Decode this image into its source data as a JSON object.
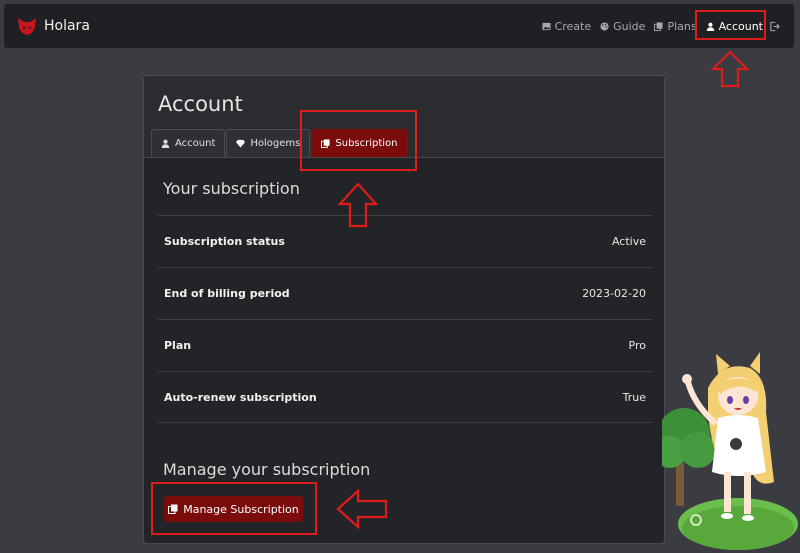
{
  "navbar": {
    "brand": "Holara",
    "links": [
      {
        "label": "Create",
        "icon": "image-icon"
      },
      {
        "label": "Guide",
        "icon": "palette-icon"
      },
      {
        "label": "Plans",
        "icon": "copy-icon"
      },
      {
        "label": "Account",
        "icon": "user-icon",
        "active": true
      }
    ],
    "logout_icon": "logout-icon"
  },
  "card": {
    "title": "Account",
    "tabs": [
      {
        "label": "Account",
        "icon": "user-icon"
      },
      {
        "label": "Hologems",
        "icon": "gem-icon"
      },
      {
        "label": "Subscription",
        "icon": "copy-icon",
        "active": true
      }
    ],
    "subscription_title": "Your subscription",
    "rows": [
      {
        "label": "Subscription status",
        "value": "Active"
      },
      {
        "label": "End of billing period",
        "value": "2023-02-20"
      },
      {
        "label": "Plan",
        "value": "Pro"
      },
      {
        "label": "Auto-renew subscription",
        "value": "True"
      }
    ],
    "manage_title": "Manage your subscription",
    "manage_button": "Manage Subscription"
  },
  "colors": {
    "accent": "#7a0c0c",
    "annotation": "#e01b1b",
    "background": "#3a3c41",
    "card": "#232427"
  }
}
